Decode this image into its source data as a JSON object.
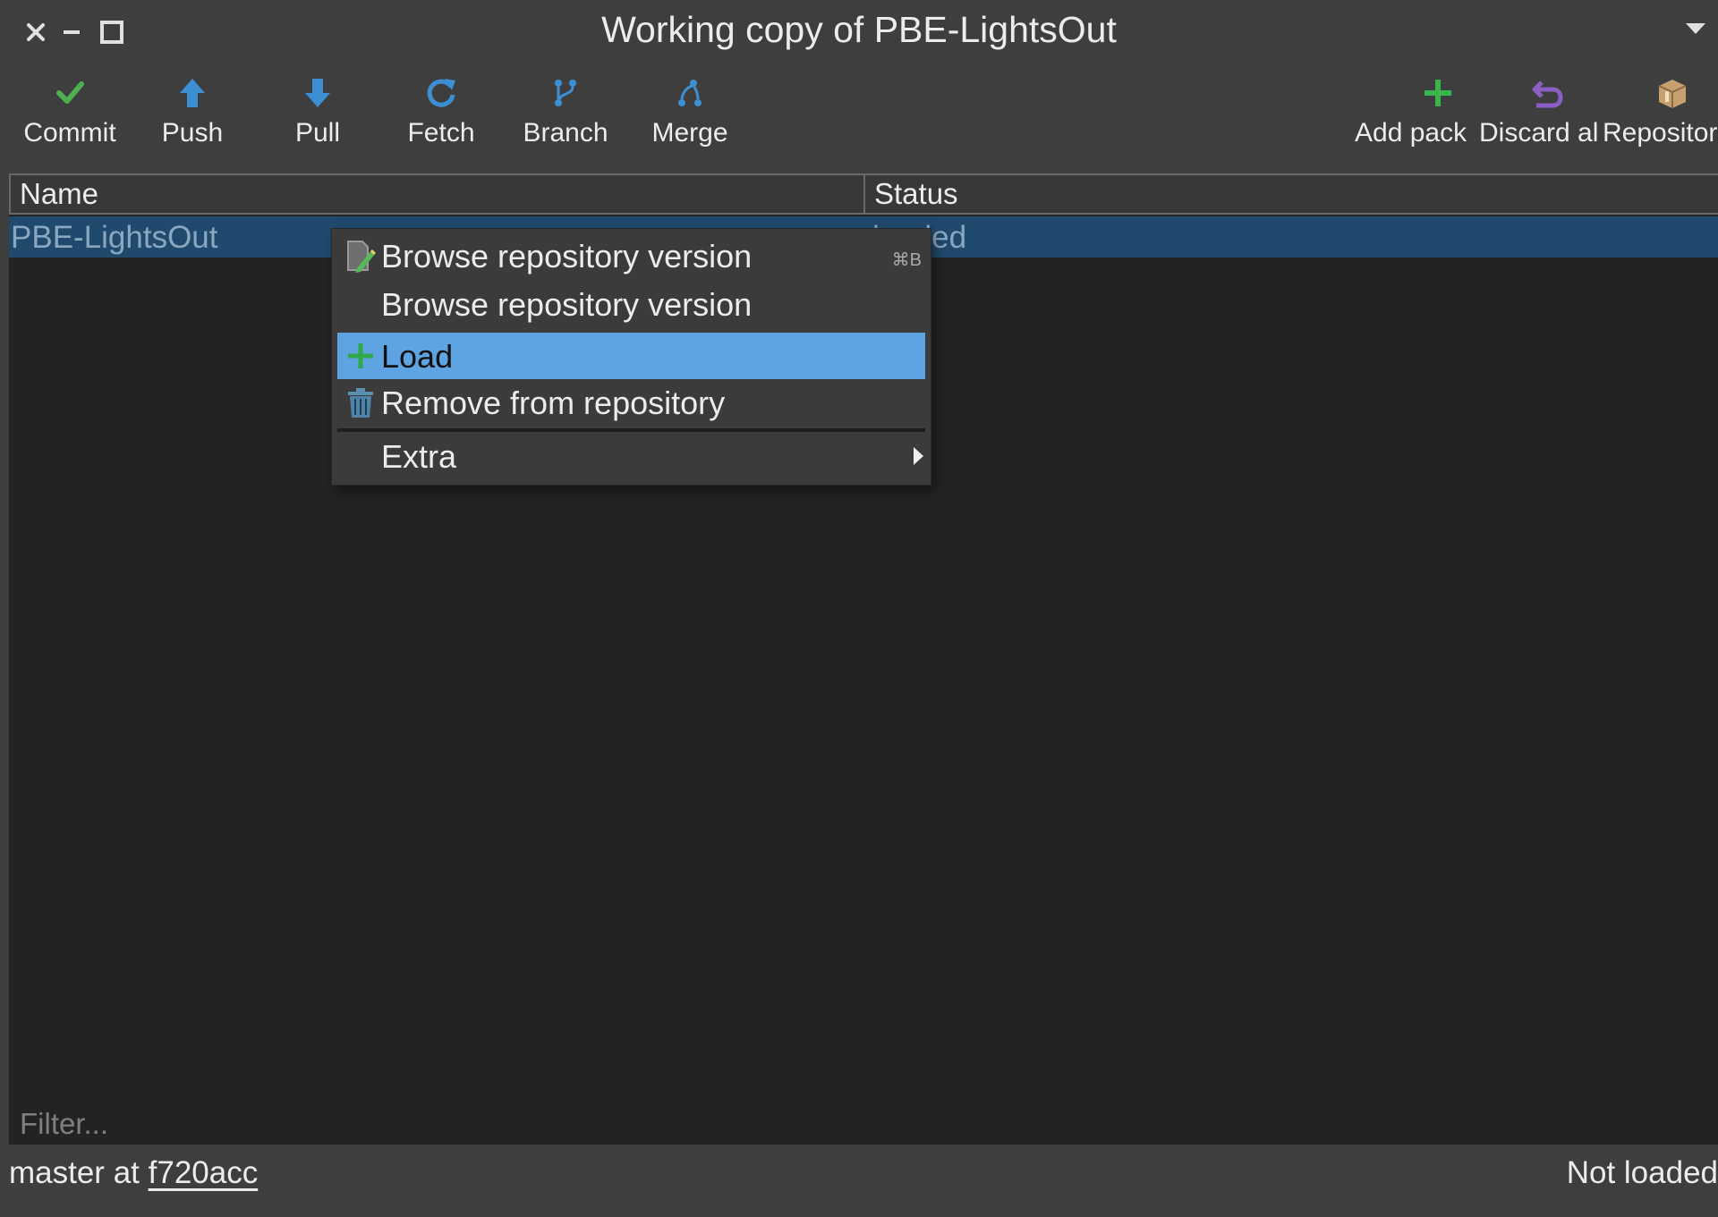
{
  "window": {
    "title": "Working copy of PBE-LightsOut"
  },
  "toolbar": {
    "items": [
      {
        "label": "Commit",
        "icon": "checkmark-icon",
        "color": "#4caf50"
      },
      {
        "label": "Push",
        "icon": "arrow-up-icon",
        "color": "#3d8fd4"
      },
      {
        "label": "Pull",
        "icon": "arrow-down-icon",
        "color": "#3d8fd4"
      },
      {
        "label": "Fetch",
        "icon": "refresh-icon",
        "color": "#3d8fd4"
      },
      {
        "label": "Branch",
        "icon": "branch-icon",
        "color": "#3d8fd4"
      },
      {
        "label": "Merge",
        "icon": "merge-icon",
        "color": "#3d8fd4"
      },
      {
        "label": "Add pack",
        "icon": "plus-icon",
        "color": "#3ab54a"
      },
      {
        "label": "Discard al",
        "icon": "undo-icon",
        "color": "#8b5fc4"
      },
      {
        "label": "Repositor",
        "icon": "package-icon",
        "color": "#c8a070"
      }
    ]
  },
  "table": {
    "columns": [
      "Name",
      "Status"
    ],
    "rows": [
      {
        "name": "PBE-LightsOut",
        "status": "loaded",
        "selected": true
      }
    ]
  },
  "filter": {
    "placeholder": "Filter..."
  },
  "statusbar": {
    "branch_prefix": "master at",
    "commit": "f720acc",
    "state": "Not loaded"
  },
  "context_menu": {
    "items": [
      {
        "label": "Browse repository version",
        "icon": "browse-document-icon",
        "shortcut": "⌘B"
      },
      {
        "label": "Browse repository version",
        "icon": ""
      },
      {
        "label": "Load",
        "icon": "plus-icon",
        "active": true
      },
      {
        "label": "Remove from repository",
        "icon": "trash-icon"
      },
      {
        "label": "Extra",
        "submenu": true
      }
    ]
  },
  "colors": {
    "background": "#3e3e3e",
    "table_background": "#232323",
    "selection": "#1f4a6e",
    "menu_highlight": "#5ea3e2"
  }
}
